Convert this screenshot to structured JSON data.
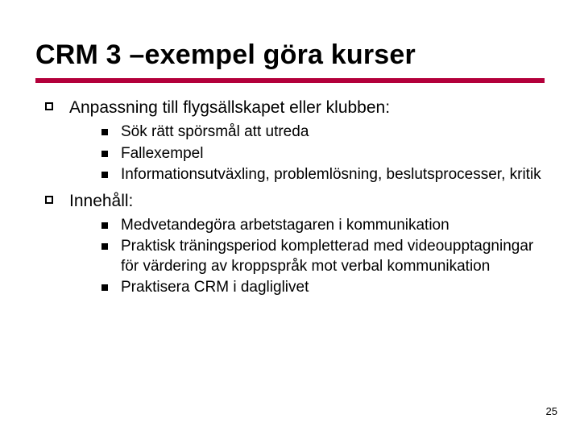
{
  "title": "CRM 3 –exempel göra kurser",
  "sections": [
    {
      "heading": "Anpassning till flygsällskapet eller klubben:",
      "items": [
        "Sök rätt spörsmål att utreda",
        "Fallexempel",
        "Informationsutväxling, problemlösning, beslutsprocesser, kritik"
      ]
    },
    {
      "heading": "Innehåll:",
      "items": [
        "Medvetandegöra arbetstagaren i kommunikation",
        "Praktisk träningsperiod kompletterad med videoupptagningar för värdering av kroppspråk mot verbal kommunikation",
        "Praktisera CRM i dagliglivet"
      ]
    }
  ],
  "page_number": "25"
}
